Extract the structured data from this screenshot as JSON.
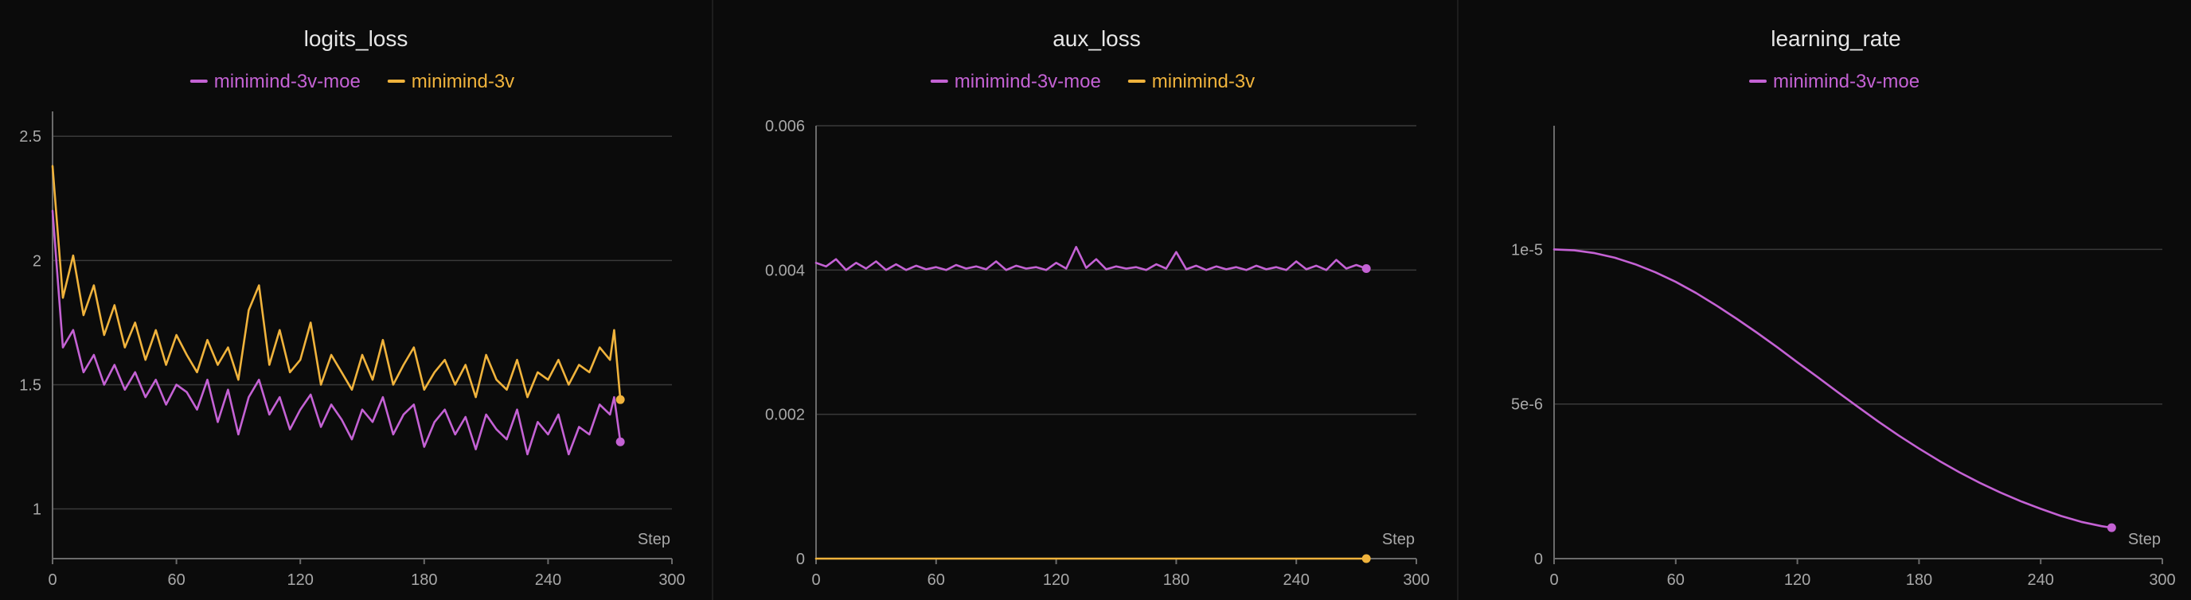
{
  "colors": {
    "background": "#0b0b0b",
    "moe": "#c462d4",
    "dense": "#f0b33c",
    "grid": "#3a3a3a",
    "axis": "#6b6b6b",
    "text": "#e6e6e6",
    "tick_text": "#a8a8a8"
  },
  "chart_data": [
    {
      "type": "line",
      "title": "logits_loss",
      "xlabel": "Step",
      "ylabel": "",
      "xlim": [
        0,
        300
      ],
      "ylim": [
        0.8,
        2.6
      ],
      "xticks": [
        0,
        60,
        120,
        180,
        240,
        300
      ],
      "xtick_labels": [
        "0",
        "60",
        "120",
        "180",
        "240",
        "300"
      ],
      "yticks": [
        1,
        1.5,
        2,
        2.5
      ],
      "ytick_labels": [
        "1",
        "1.5",
        "2",
        "2.5"
      ],
      "grid": true,
      "legend": "top-center",
      "series": [
        {
          "name": "minimind-3v-moe",
          "color": "#c462d4",
          "x": [
            0,
            5,
            10,
            15,
            20,
            25,
            30,
            35,
            40,
            45,
            50,
            55,
            60,
            65,
            70,
            75,
            80,
            85,
            90,
            95,
            100,
            105,
            110,
            115,
            120,
            125,
            130,
            135,
            140,
            145,
            150,
            155,
            160,
            165,
            170,
            175,
            180,
            185,
            190,
            195,
            200,
            205,
            210,
            215,
            220,
            225,
            230,
            235,
            240,
            245,
            250,
            255,
            260,
            265,
            270,
            272,
            275
          ],
          "y": [
            2.2,
            1.65,
            1.72,
            1.55,
            1.62,
            1.5,
            1.58,
            1.48,
            1.55,
            1.45,
            1.52,
            1.42,
            1.5,
            1.47,
            1.4,
            1.52,
            1.35,
            1.48,
            1.3,
            1.45,
            1.52,
            1.38,
            1.45,
            1.32,
            1.4,
            1.46,
            1.33,
            1.42,
            1.36,
            1.28,
            1.4,
            1.35,
            1.45,
            1.3,
            1.38,
            1.42,
            1.25,
            1.35,
            1.4,
            1.3,
            1.37,
            1.24,
            1.38,
            1.32,
            1.28,
            1.4,
            1.22,
            1.35,
            1.3,
            1.38,
            1.22,
            1.33,
            1.3,
            1.42,
            1.38,
            1.45,
            1.27
          ]
        },
        {
          "name": "minimind-3v",
          "color": "#f0b33c",
          "x": [
            0,
            5,
            10,
            15,
            20,
            25,
            30,
            35,
            40,
            45,
            50,
            55,
            60,
            65,
            70,
            75,
            80,
            85,
            90,
            95,
            100,
            105,
            110,
            115,
            120,
            125,
            130,
            135,
            140,
            145,
            150,
            155,
            160,
            165,
            170,
            175,
            180,
            185,
            190,
            195,
            200,
            205,
            210,
            215,
            220,
            225,
            230,
            235,
            240,
            245,
            250,
            255,
            260,
            265,
            270,
            272,
            275
          ],
          "y": [
            2.38,
            1.85,
            2.02,
            1.78,
            1.9,
            1.7,
            1.82,
            1.65,
            1.75,
            1.6,
            1.72,
            1.58,
            1.7,
            1.62,
            1.55,
            1.68,
            1.58,
            1.65,
            1.52,
            1.8,
            1.9,
            1.58,
            1.72,
            1.55,
            1.6,
            1.75,
            1.5,
            1.62,
            1.55,
            1.48,
            1.62,
            1.52,
            1.68,
            1.5,
            1.58,
            1.65,
            1.48,
            1.55,
            1.6,
            1.5,
            1.58,
            1.45,
            1.62,
            1.52,
            1.48,
            1.6,
            1.45,
            1.55,
            1.52,
            1.6,
            1.5,
            1.58,
            1.55,
            1.65,
            1.6,
            1.72,
            1.44
          ]
        }
      ]
    },
    {
      "type": "line",
      "title": "aux_loss",
      "xlabel": "Step",
      "ylabel": "",
      "xlim": [
        0,
        300
      ],
      "ylim": [
        0,
        0.006
      ],
      "xticks": [
        0,
        60,
        120,
        180,
        240,
        300
      ],
      "xtick_labels": [
        "0",
        "60",
        "120",
        "180",
        "240",
        "300"
      ],
      "yticks": [
        0,
        0.002,
        0.004,
        0.006
      ],
      "ytick_labels": [
        "0",
        "0.002",
        "0.004",
        "0.006"
      ],
      "grid": true,
      "legend": "top-center",
      "series": [
        {
          "name": "minimind-3v-moe",
          "color": "#c462d4",
          "x": [
            0,
            5,
            10,
            15,
            20,
            25,
            30,
            35,
            40,
            45,
            50,
            55,
            60,
            65,
            70,
            75,
            80,
            85,
            90,
            95,
            100,
            105,
            110,
            115,
            120,
            125,
            130,
            135,
            140,
            145,
            150,
            155,
            160,
            165,
            170,
            175,
            180,
            185,
            190,
            195,
            200,
            205,
            210,
            215,
            220,
            225,
            230,
            235,
            240,
            245,
            250,
            255,
            260,
            265,
            270,
            275
          ],
          "y": [
            0.0041,
            0.00405,
            0.00415,
            0.004,
            0.0041,
            0.00402,
            0.00412,
            0.004,
            0.00408,
            0.004,
            0.00406,
            0.00401,
            0.00404,
            0.004,
            0.00407,
            0.00402,
            0.00405,
            0.00401,
            0.00412,
            0.004,
            0.00406,
            0.00402,
            0.00404,
            0.004,
            0.0041,
            0.00402,
            0.00432,
            0.00403,
            0.00415,
            0.00401,
            0.00405,
            0.00402,
            0.00404,
            0.004,
            0.00408,
            0.00402,
            0.00425,
            0.00401,
            0.00406,
            0.004,
            0.00405,
            0.00401,
            0.00404,
            0.004,
            0.00406,
            0.00401,
            0.00404,
            0.004,
            0.00412,
            0.00401,
            0.00406,
            0.004,
            0.00414,
            0.00402,
            0.00407,
            0.00402
          ]
        },
        {
          "name": "minimind-3v",
          "color": "#f0b33c",
          "x": [
            0,
            275
          ],
          "y": [
            0,
            0
          ]
        }
      ]
    },
    {
      "type": "line",
      "title": "learning_rate",
      "xlabel": "Step",
      "ylabel": "",
      "xlim": [
        0,
        300
      ],
      "ylim": [
        0,
        1.4e-05
      ],
      "xticks": [
        0,
        60,
        120,
        180,
        240,
        300
      ],
      "xtick_labels": [
        "0",
        "60",
        "120",
        "180",
        "240",
        "300"
      ],
      "yticks": [
        0,
        5e-06,
        1e-05
      ],
      "ytick_labels": [
        "0",
        "5e-6",
        "1e-5"
      ],
      "grid": true,
      "legend": "top-center",
      "series": [
        {
          "name": "minimind-3v-moe",
          "color": "#c462d4",
          "x": [
            0,
            10,
            20,
            30,
            40,
            50,
            60,
            70,
            80,
            90,
            100,
            110,
            120,
            130,
            140,
            150,
            160,
            170,
            180,
            190,
            200,
            210,
            220,
            230,
            240,
            250,
            260,
            270,
            275
          ],
          "y": [
            1e-05,
            9.97e-06,
            9.88e-06,
            9.73e-06,
            9.52e-06,
            9.26e-06,
            8.95e-06,
            8.59e-06,
            8.19e-06,
            7.76e-06,
            7.31e-06,
            6.84e-06,
            6.35e-06,
            5.87e-06,
            5.38e-06,
            4.9e-06,
            4.43e-06,
            3.98e-06,
            3.56e-06,
            3.16e-06,
            2.79e-06,
            2.45e-06,
            2.14e-06,
            1.86e-06,
            1.61e-06,
            1.38e-06,
            1.19e-06,
            1.05e-06,
            1e-06
          ]
        }
      ]
    }
  ]
}
